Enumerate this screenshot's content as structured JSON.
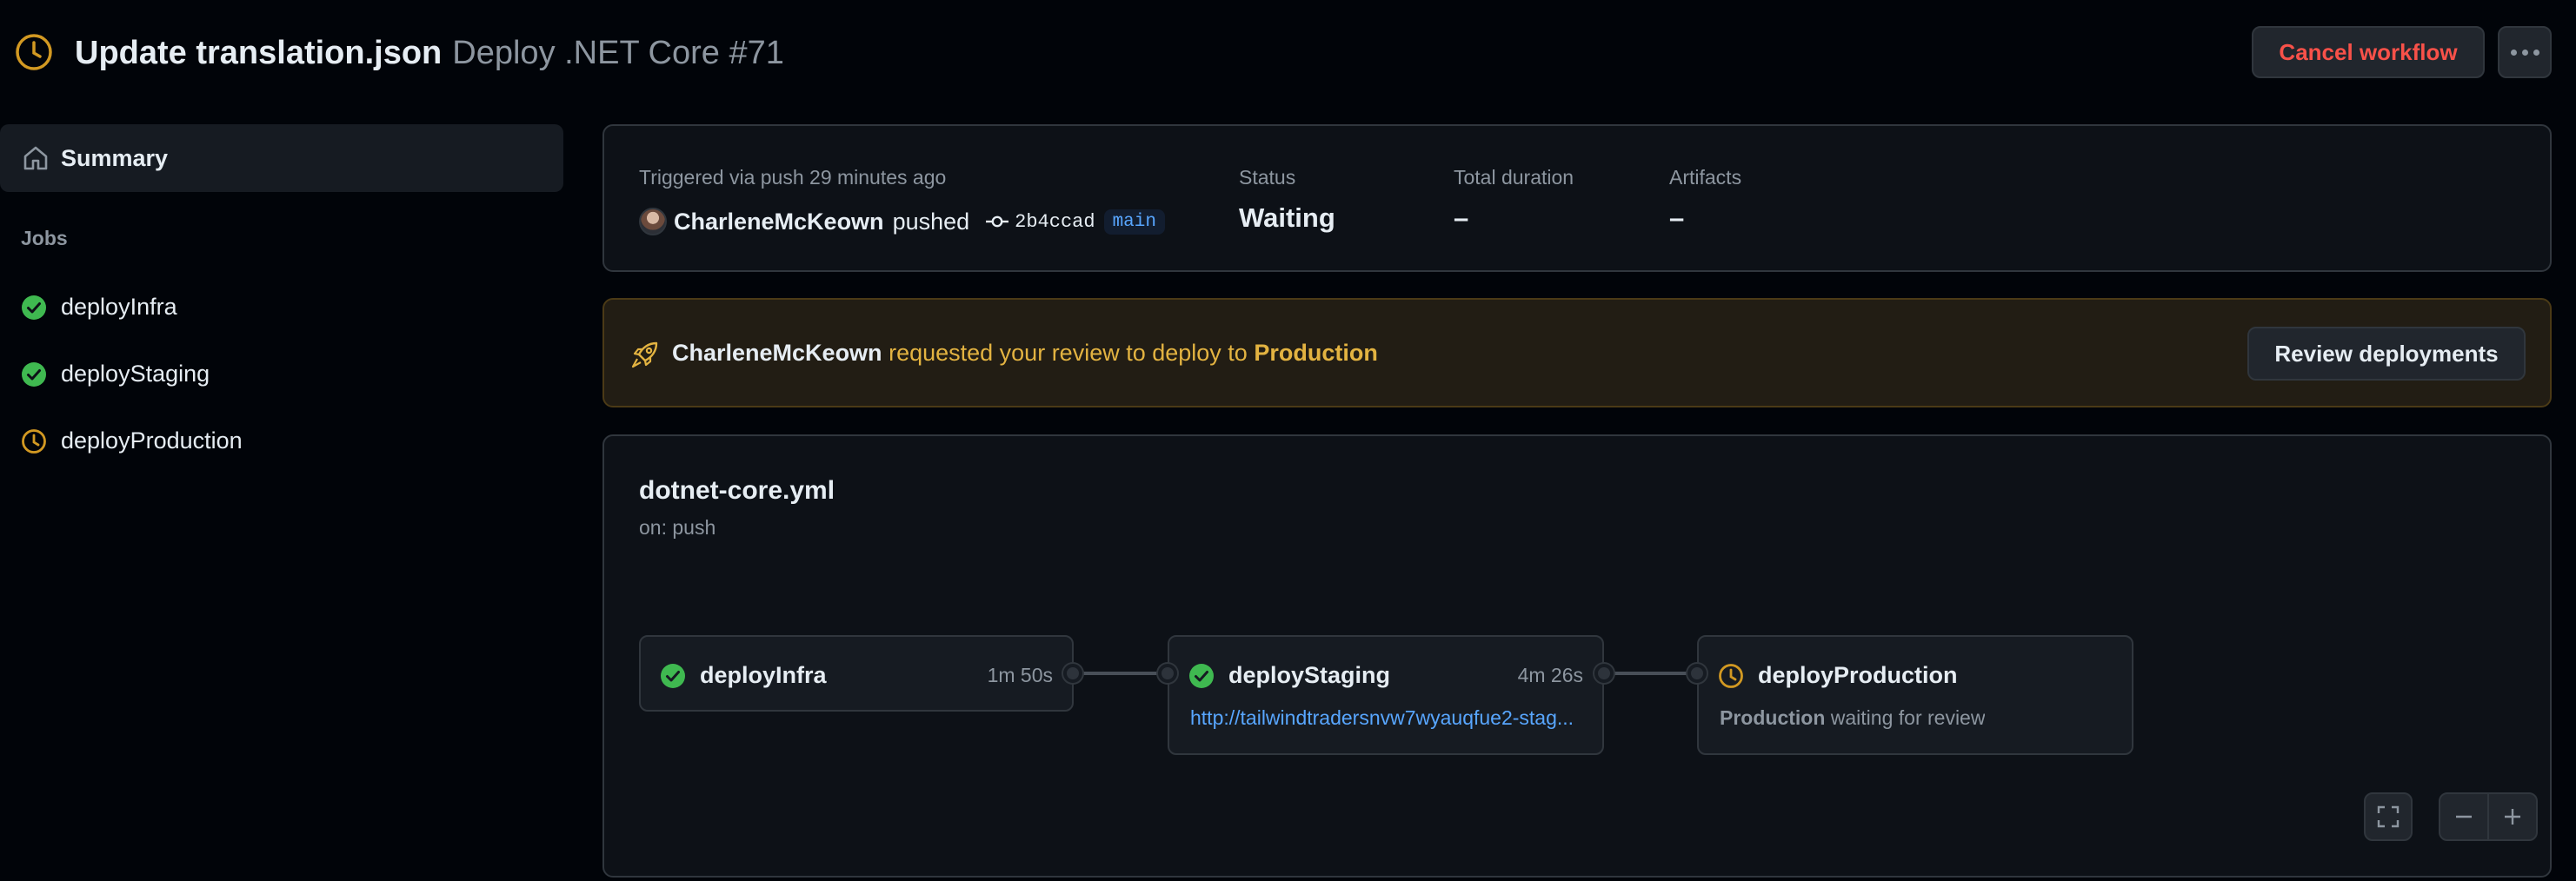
{
  "header": {
    "title": "Update translation.json",
    "subtitle": "Deploy .NET Core #71",
    "cancel_label": "Cancel workflow",
    "more_icon": "kebab-horizontal-icon",
    "status_icon": "clock-icon"
  },
  "sidebar": {
    "summary_label": "Summary",
    "jobs_heading": "Jobs",
    "jobs": [
      {
        "label": "deployInfra",
        "status": "success"
      },
      {
        "label": "deployStaging",
        "status": "success"
      },
      {
        "label": "deployProduction",
        "status": "waiting"
      }
    ]
  },
  "summary": {
    "triggered_label": "Triggered via push 29 minutes ago",
    "user": "CharleneMcKeown",
    "action": "pushed",
    "commit": "2b4ccad",
    "branch": "main",
    "status_label": "Status",
    "status_value": "Waiting",
    "duration_label": "Total duration",
    "duration_value": "–",
    "artifacts_label": "Artifacts",
    "artifacts_value": "–"
  },
  "review": {
    "user": "CharleneMcKeown",
    "message": "requested your review to deploy to",
    "environment": "Production",
    "button_label": "Review deployments"
  },
  "graph": {
    "workflow_file": "dotnet-core.yml",
    "trigger": "on: push",
    "nodes": [
      {
        "name": "deployInfra",
        "duration": "1m 50s",
        "status": "success"
      },
      {
        "name": "deployStaging",
        "duration": "4m 26s",
        "status": "success",
        "url": "http://tailwindtradersnvw7wyauqfue2-stag..."
      },
      {
        "name": "deployProduction",
        "status": "waiting",
        "env": "Production",
        "waiting_text": "waiting for review"
      }
    ]
  },
  "colors": {
    "success": "#3fb950",
    "waiting": "#d29922",
    "danger": "#f85149",
    "link": "#58a6ff"
  }
}
